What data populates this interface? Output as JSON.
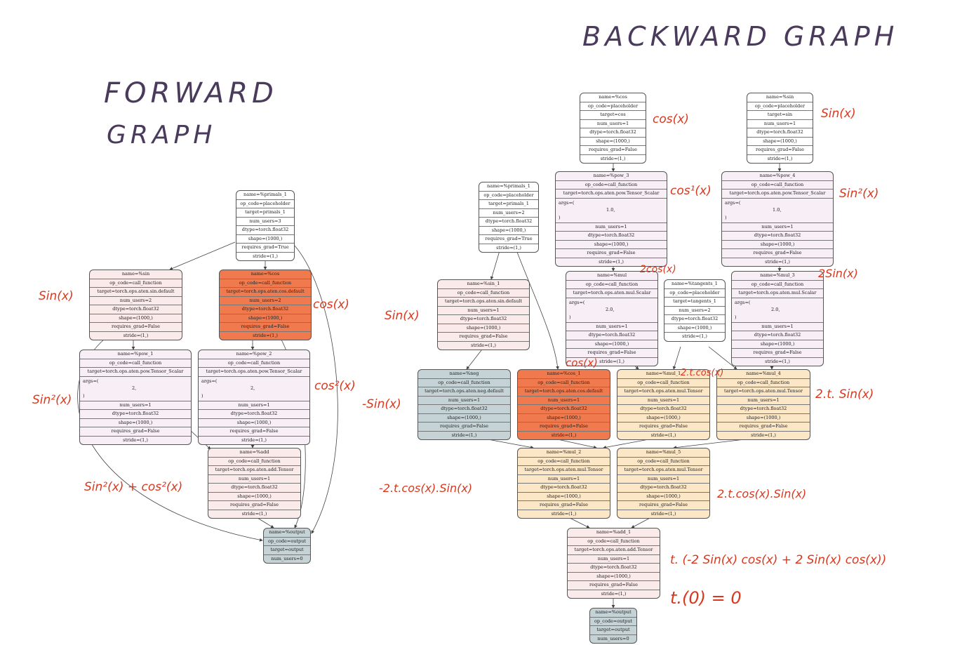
{
  "titles": {
    "forward": [
      "FORWARD",
      "GRAPH"
    ],
    "backward": "BACKWARD GRAPH"
  },
  "colors": {
    "orange_node": "#f07a4d",
    "peach_node": "#fbe6c6",
    "slate_node": "#c6d3d6",
    "pink_node": "#fbeaea",
    "annotation": "#d9381e",
    "title_ink": "#4a3a5c"
  },
  "forward_nodes": {
    "primals_1": [
      "name=%primals_1",
      "op_code=placeholder",
      "target=primals_1",
      "num_users=3",
      "dtype=torch.float32",
      "shape=(1000,)",
      "requires_grad=True",
      "stride=(1,)"
    ],
    "sin": [
      "name=%sin",
      "op_code=call_function",
      "target=torch.ops.aten.sin.default",
      "num_users=2",
      "dtype=torch.float32",
      "shape=(1000,)",
      "requires_grad=False",
      "stride=(1,)"
    ],
    "cos": [
      "name=%cos",
      "op_code=call_function",
      "target=torch.ops.aten.cos.default",
      "num_users=2",
      "dtype=torch.float32",
      "shape=(1000,)",
      "requires_grad=False",
      "stride=(1,)"
    ],
    "pow_1": {
      "head": [
        "name=%pow_1",
        "op_code=call_function",
        "target=torch.ops.aten.pow.Tensor_Scalar"
      ],
      "args": [
        "args=(",
        "2,",
        ")"
      ],
      "tail": [
        "num_users=1",
        "dtype=torch.float32",
        "shape=(1000,)",
        "requires_grad=False",
        "stride=(1,)"
      ]
    },
    "pow_2": {
      "head": [
        "name=%pow_2",
        "op_code=call_function",
        "target=torch.ops.aten.pow.Tensor_Scalar"
      ],
      "args": [
        "args=(",
        "2,",
        ")"
      ],
      "tail": [
        "num_users=1",
        "dtype=torch.float32",
        "shape=(1000,)",
        "requires_grad=False",
        "stride=(1,)"
      ]
    },
    "add": [
      "name=%add",
      "op_code=call_function",
      "target=torch.ops.aten.add.Tensor",
      "num_users=1",
      "dtype=torch.float32",
      "shape=(1000,)",
      "requires_grad=False",
      "stride=(1,)"
    ],
    "output": [
      "name=%output",
      "op_code=output",
      "target=output",
      "num_users=0"
    ]
  },
  "backward_nodes": {
    "cos_in": [
      "name=%cos",
      "op_code=placeholder",
      "target=cos",
      "num_users=1",
      "dtype=torch.float32",
      "shape=(1000,)",
      "requires_grad=False",
      "stride=(1,)"
    ],
    "sin_in": [
      "name=%sin",
      "op_code=placeholder",
      "target=sin",
      "num_users=1",
      "dtype=torch.float32",
      "shape=(1000,)",
      "requires_grad=False",
      "stride=(1,)"
    ],
    "pow_3": {
      "head": [
        "name=%pow_3",
        "op_code=call_function",
        "target=torch.ops.aten.pow.Tensor_Scalar"
      ],
      "args": [
        "args=(",
        "1.0,",
        ")"
      ],
      "tail": [
        "num_users=1",
        "dtype=torch.float32",
        "shape=(1000,)",
        "requires_grad=False",
        "stride=(1,)"
      ]
    },
    "pow_4": {
      "head": [
        "name=%pow_4",
        "op_code=call_function",
        "target=torch.ops.aten.pow.Tensor_Scalar"
      ],
      "args": [
        "args=(",
        "1.0,",
        ")"
      ],
      "tail": [
        "num_users=1",
        "dtype=torch.float32",
        "shape=(1000,)",
        "requires_grad=False",
        "stride=(1,)"
      ]
    },
    "primals_1": [
      "name=%primals_1",
      "op_code=placeholder",
      "target=primals_1",
      "num_users=2",
      "dtype=torch.float32",
      "shape=(1000,)",
      "requires_grad=True",
      "stride=(1,)"
    ],
    "sin_1": [
      "name=%sin_1",
      "op_code=call_function",
      "target=torch.ops.aten.sin.default",
      "num_users=1",
      "dtype=torch.float32",
      "shape=(1000,)",
      "requires_grad=False",
      "stride=(1,)"
    ],
    "mul": {
      "head": [
        "name=%mul",
        "op_code=call_function",
        "target=torch.ops.aten.mul.Scalar"
      ],
      "args": [
        "args=(",
        "2.0,",
        ")"
      ],
      "tail": [
        "num_users=1",
        "dtype=torch.float32",
        "shape=(1000,)",
        "requires_grad=False",
        "stride=(1,)"
      ]
    },
    "tangents_1": [
      "name=%tangents_1",
      "op_code=placeholder",
      "target=tangents_1",
      "num_users=2",
      "dtype=torch.float32",
      "shape=(1000,)",
      "stride=(1,)"
    ],
    "mul_3": {
      "head": [
        "name=%mul_3",
        "op_code=call_function",
        "target=torch.ops.aten.mul.Scalar"
      ],
      "args": [
        "args=(",
        "2.0,",
        ")"
      ],
      "tail": [
        "num_users=1",
        "dtype=torch.float32",
        "shape=(1000,)",
        "requires_grad=False",
        "stride=(1,)"
      ]
    },
    "neg": [
      "name=%neg",
      "op_code=call_function",
      "target=torch.ops.aten.neg.default",
      "num_users=1",
      "dtype=torch.float32",
      "shape=(1000,)",
      "requires_grad=False",
      "stride=(1,)"
    ],
    "cos_1": [
      "name=%cos_1",
      "op_code=call_function",
      "target=torch.ops.aten.cos.default",
      "num_users=1",
      "dtype=torch.float32",
      "shape=(1000,)",
      "requires_grad=False",
      "stride=(1,)"
    ],
    "mul_1": [
      "name=%mul_1",
      "op_code=call_function",
      "target=torch.ops.aten.mul.Tensor",
      "num_users=1",
      "dtype=torch.float32",
      "shape=(1000,)",
      "requires_grad=False",
      "stride=(1,)"
    ],
    "mul_4": [
      "name=%mul_4",
      "op_code=call_function",
      "target=torch.ops.aten.mul.Tensor",
      "num_users=1",
      "dtype=torch.float32",
      "shape=(1000,)",
      "requires_grad=False",
      "stride=(1,)"
    ],
    "mul_2": [
      "name=%mul_2",
      "op_code=call_function",
      "target=torch.ops.aten.mul.Tensor",
      "num_users=1",
      "dtype=torch.float32",
      "shape=(1000,)",
      "requires_grad=False",
      "stride=(1,)"
    ],
    "mul_5": [
      "name=%mul_5",
      "op_code=call_function",
      "target=torch.ops.aten.mul.Tensor",
      "num_users=1",
      "dtype=torch.float32",
      "shape=(1000,)",
      "requires_grad=False",
      "stride=(1,)"
    ],
    "add_1": [
      "name=%add_1",
      "op_code=call_function",
      "target=torch.ops.aten.add.Tensor",
      "num_users=1",
      "dtype=torch.float32",
      "shape=(1000,)",
      "requires_grad=False",
      "stride=(1,)"
    ],
    "output": [
      "name=%output",
      "op_code=output",
      "target=output",
      "num_users=0"
    ]
  },
  "annotations": {
    "fwd_sin": "Sin(x)",
    "fwd_cos": "cos(x)",
    "fwd_sin2": "Sin²(x)",
    "fwd_cos2": "cos²(x)",
    "fwd_sum": "Sin²(x) + cos²(x)",
    "bwd_cos": "cos(x)",
    "bwd_sin": "Sin(x)",
    "bwd_cos1": "cos¹(x)",
    "bwd_sin2": "Sin²(x)",
    "bwd_2cos": "2cos(x)",
    "bwd_2sin": "2Sin(x)",
    "bwd_sinx": "Sin(x)",
    "bwd_cosx": "cos(x)",
    "bwd_neg_sin": "-Sin(x)",
    "bwd_2tcos": "2.t.cos(x)",
    "bwd_2tsin": "2.t. Sin(x)",
    "bwd_neg_prod": "-2.t.cos(x).Sin(x)",
    "bwd_prod": "2.t.cos(x).Sin(x)",
    "bwd_total": "t. (-2 Sin(x) cos(x) + 2 Sin(x) cos(x))",
    "bwd_zero": "t.(0) = 0"
  }
}
